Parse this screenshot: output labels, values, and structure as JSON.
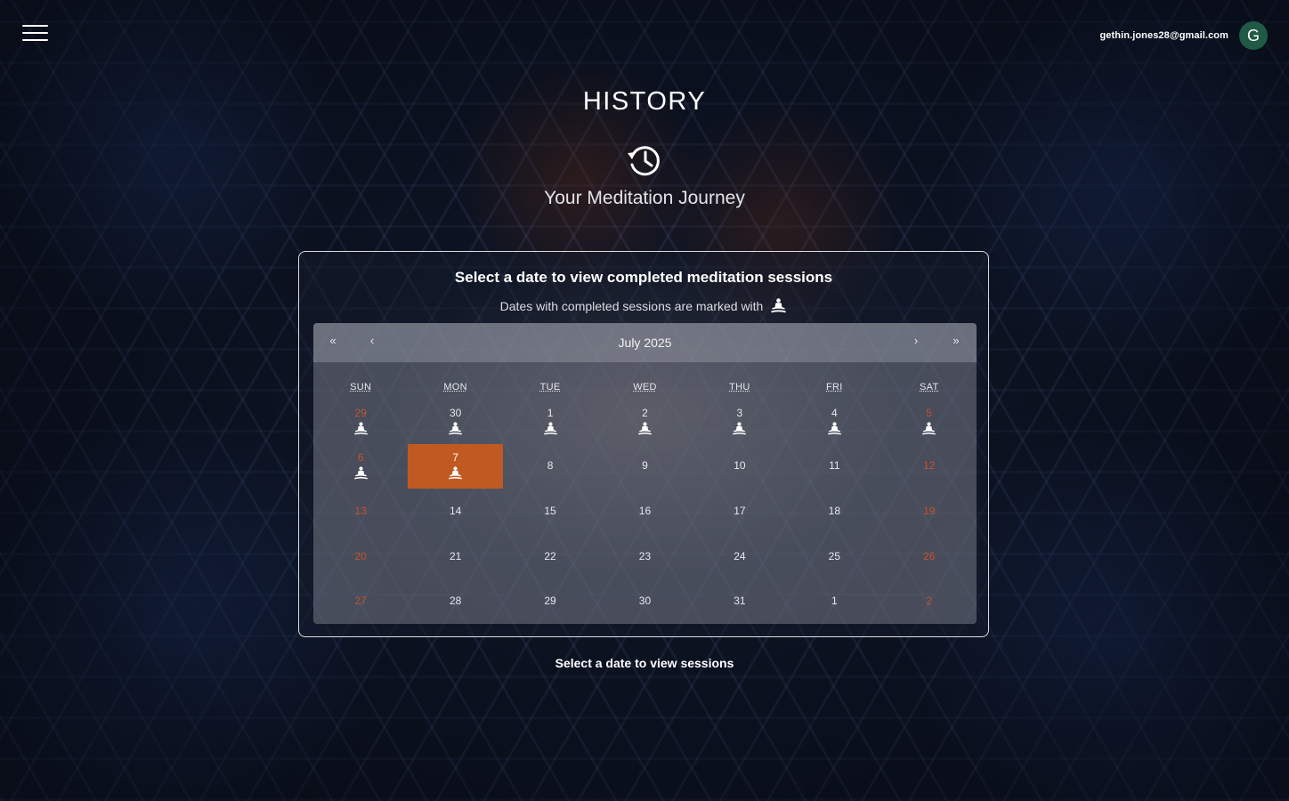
{
  "header": {
    "user_email": "gethin.jones28@gmail.com",
    "avatar_initial": "G"
  },
  "page": {
    "title": "HISTORY",
    "subtitle": "Your Meditation Journey"
  },
  "card": {
    "title": "Select a date to view completed meditation sessions",
    "subtitle": "Dates with completed sessions are marked with"
  },
  "calendar": {
    "month_label": "July 2025",
    "nav": {
      "prev_year": "«",
      "prev_month": "‹",
      "next_month": "›",
      "next_year": "»"
    },
    "weekdays": [
      "SUN",
      "MON",
      "TUE",
      "WED",
      "THU",
      "FRI",
      "SAT"
    ],
    "weeks": [
      [
        {
          "day": "29",
          "session": true
        },
        {
          "day": "30",
          "session": true
        },
        {
          "day": "1",
          "session": true
        },
        {
          "day": "2",
          "session": true
        },
        {
          "day": "3",
          "session": true
        },
        {
          "day": "4",
          "session": true
        },
        {
          "day": "5",
          "session": true
        }
      ],
      [
        {
          "day": "6",
          "session": true
        },
        {
          "day": "7",
          "session": true,
          "selected": true
        },
        {
          "day": "8"
        },
        {
          "day": "9"
        },
        {
          "day": "10"
        },
        {
          "day": "11"
        },
        {
          "day": "12"
        }
      ],
      [
        {
          "day": "13"
        },
        {
          "day": "14"
        },
        {
          "day": "15"
        },
        {
          "day": "16"
        },
        {
          "day": "17"
        },
        {
          "day": "18"
        },
        {
          "day": "19"
        }
      ],
      [
        {
          "day": "20"
        },
        {
          "day": "21"
        },
        {
          "day": "22"
        },
        {
          "day": "23"
        },
        {
          "day": "24"
        },
        {
          "day": "25"
        },
        {
          "day": "26"
        }
      ],
      [
        {
          "day": "27"
        },
        {
          "day": "28"
        },
        {
          "day": "29"
        },
        {
          "day": "30"
        },
        {
          "day": "31"
        },
        {
          "day": "1"
        },
        {
          "day": "2"
        }
      ]
    ],
    "session_icon": "meditation-icon"
  },
  "footer": {
    "text": "Select a date to view sessions"
  },
  "colors": {
    "selected_day": "#c05a22",
    "weekend_text": "#c0542a",
    "avatar_bg": "#1f5a44"
  }
}
